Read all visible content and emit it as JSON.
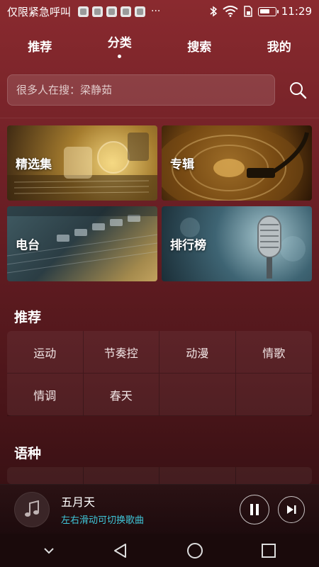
{
  "status_bar": {
    "carrier_text": "仅限紧急呼叫",
    "overflow": "···",
    "time": "11:29",
    "battery_level": 0.7
  },
  "tabs": [
    {
      "label": "推荐",
      "active": false
    },
    {
      "label": "分类",
      "active": true
    },
    {
      "label": "搜索",
      "active": false
    },
    {
      "label": "我的",
      "active": false
    }
  ],
  "search": {
    "placeholder": "很多人在搜：梁静茹"
  },
  "categories": [
    {
      "label": "精选集"
    },
    {
      "label": "专辑"
    },
    {
      "label": "电台"
    },
    {
      "label": "排行榜"
    }
  ],
  "recommend": {
    "title": "推荐",
    "tags": [
      "运动",
      "节奏控",
      "动漫",
      "情歌",
      "情调",
      "春天",
      "",
      ""
    ]
  },
  "language": {
    "title": "语种"
  },
  "player": {
    "song_title": "五月天",
    "hint": "左右滑动可切换歌曲"
  },
  "colors": {
    "accent_hint": "#3fc7da",
    "background_top": "#8a2a2f",
    "background_bottom": "#2b0d10"
  }
}
